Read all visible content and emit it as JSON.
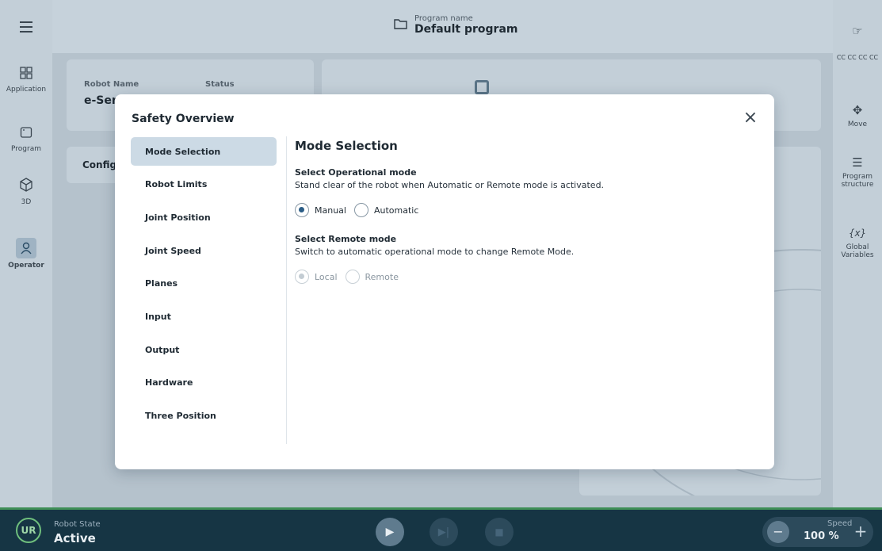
{
  "header": {
    "program_caption": "Program name",
    "program_name": "Default program"
  },
  "left_nav": {
    "items": [
      {
        "label": "Application",
        "icon": "grid-icon"
      },
      {
        "label": "Program",
        "icon": "window-icon"
      },
      {
        "label": "3D",
        "icon": "cube-icon"
      },
      {
        "label": "Operator",
        "icon": "user-icon",
        "active": true
      }
    ]
  },
  "right_nav": {
    "items": [
      {
        "label": "",
        "icon": "gesture-icon"
      },
      {
        "label": "CC CC CC CC",
        "icon": ""
      },
      {
        "label": "Move",
        "icon": "move-arrows-icon"
      },
      {
        "label": "Program structure",
        "icon": "list-icon"
      },
      {
        "label": "Global Variables",
        "icon": "variable-icon"
      }
    ]
  },
  "background_cards": {
    "robot_name_label": "Robot Name",
    "robot_name_value": "e-Seri",
    "status_label": "Status",
    "config_label": "Config"
  },
  "modal": {
    "title": "Safety Overview",
    "nav": [
      {
        "label": "Mode Selection",
        "active": true
      },
      {
        "label": "Robot Limits"
      },
      {
        "label": "Joint Position"
      },
      {
        "label": "Joint Speed"
      },
      {
        "label": "Planes"
      },
      {
        "label": "Input"
      },
      {
        "label": "Output"
      },
      {
        "label": "Hardware"
      },
      {
        "label": "Three Position"
      }
    ],
    "pane": {
      "title": "Mode Selection",
      "operational": {
        "title": "Select Operational mode",
        "description": "Stand clear of the robot when Automatic or Remote mode is activated.",
        "options": [
          "Manual",
          "Automatic"
        ],
        "selected": "Manual"
      },
      "remote": {
        "title": "Select Remote mode",
        "description": "Switch to automatic operational mode to change Remote Mode.",
        "options": [
          "Local",
          "Remote"
        ],
        "selected": "Local",
        "disabled": true
      }
    }
  },
  "footer": {
    "logo_text": "UR",
    "robot_state_caption": "Robot State",
    "robot_state_value": "Active",
    "speed_caption": "Speed",
    "speed_value": "100 %"
  },
  "colors": {
    "accent": "#2b5d86",
    "active_nav": "#ccdae5",
    "bottom_bar": "#163544",
    "status_green": "#3f8e57"
  }
}
